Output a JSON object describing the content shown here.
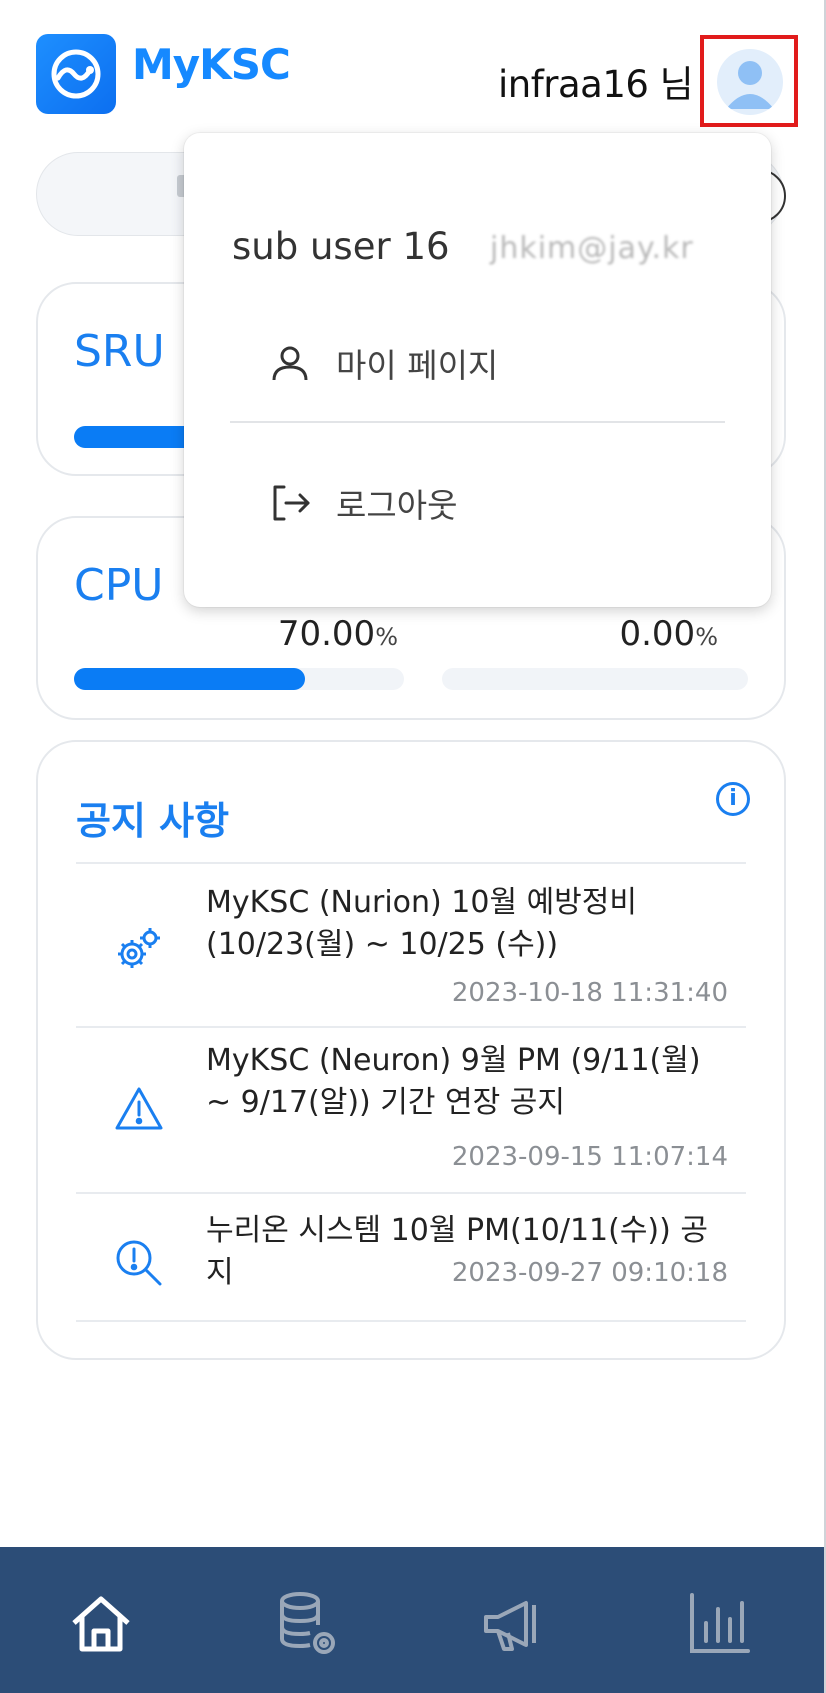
{
  "header": {
    "brand": "MyKSC",
    "username": "infraa16",
    "username_suffix": "님"
  },
  "cards": {
    "sru": {
      "title": "SRU",
      "usage_fraction": 0.31
    },
    "cpu": {
      "title": "CPU",
      "left_value": "70.00",
      "right_value": "0.00",
      "unit": "%",
      "left_fraction": 0.7,
      "right_fraction": 0.0
    }
  },
  "notices": {
    "title": "공지 사항",
    "info_symbol": "i",
    "items": [
      {
        "icon": "gears-icon",
        "text": "MyKSC (Nurion) 10월 예방정비 (10/23(월) ~ 10/25 (수))",
        "date": "2023-10-18 11:31:40"
      },
      {
        "icon": "warning-icon",
        "text": "MyKSC (Neuron) 9월 PM (9/11(월) ~ 9/17(알)) 기간 연장 공지",
        "date": "2023-09-15 11:07:14"
      },
      {
        "icon": "search-alert-icon",
        "text": "누리온 시스템 10월 PM(10/11(수)) 공지",
        "date": "2023-09-27 09:10:18"
      }
    ]
  },
  "user_menu": {
    "user_name": "sub user 16",
    "email_obscured": "jhkim@jay.kr",
    "mypage_label": "마이 페이지",
    "logout_label": "로그아웃"
  },
  "bottom_nav": {
    "items": [
      "home-icon",
      "database-settings-icon",
      "megaphone-icon",
      "chart-icon"
    ],
    "active_color": "#ffffff",
    "inactive_color": "#9aa7b8",
    "background": "#2c4d77"
  },
  "colors": {
    "accent": "#1a7ff0",
    "highlight_box": "#e11b1b"
  }
}
